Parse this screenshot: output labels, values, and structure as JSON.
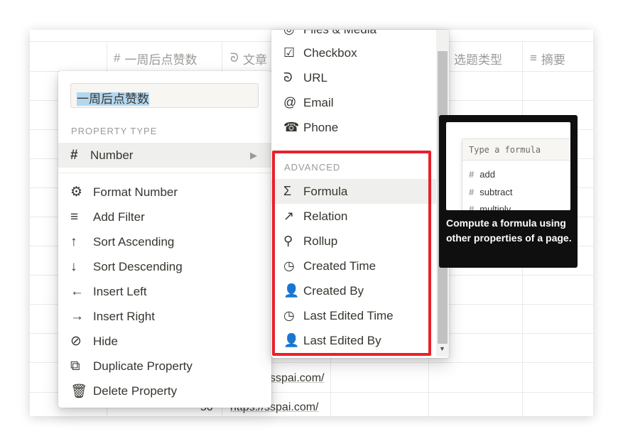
{
  "table": {
    "headers": [
      {
        "icon": "number-icon",
        "glyph": "#",
        "label": "一周后点赞数"
      },
      {
        "icon": "url-icon",
        "glyph": "ᘐ",
        "label": "文章"
      },
      {
        "icon": "select-icon",
        "glyph": "",
        "label": "选题类型"
      },
      {
        "icon": "text-icon",
        "glyph": "≡",
        "label": "摘要"
      }
    ],
    "rows_visible": [
      {
        "number": "",
        "link": "sspai.com/"
      },
      {
        "number": "50",
        "link": "https://sspai.com/"
      }
    ]
  },
  "property_menu": {
    "name_value": "一周后点赞数",
    "section_label": "PROPERTY TYPE",
    "selected_type": {
      "icon": "number-icon",
      "glyph": "#",
      "label": "Number"
    },
    "items": [
      {
        "name": "format-number",
        "icon": "gear-icon",
        "glyph": "⚙",
        "label": "Format Number"
      },
      {
        "name": "add-filter",
        "icon": "filter-icon",
        "glyph": "≡",
        "label": "Add Filter"
      },
      {
        "name": "sort-ascending",
        "icon": "arrow-up-icon",
        "glyph": "↑",
        "label": "Sort Ascending"
      },
      {
        "name": "sort-descending",
        "icon": "arrow-down-icon",
        "glyph": "↓",
        "label": "Sort Descending"
      },
      {
        "name": "insert-left",
        "icon": "arrow-left-icon",
        "glyph": "←",
        "label": "Insert Left"
      },
      {
        "name": "insert-right",
        "icon": "arrow-right-icon",
        "glyph": "→",
        "label": "Insert Right"
      },
      {
        "name": "hide",
        "icon": "eye-slash-icon",
        "glyph": "⊘",
        "label": "Hide"
      },
      {
        "name": "duplicate-property",
        "icon": "duplicate-icon",
        "glyph": "⧉",
        "label": "Duplicate Property"
      },
      {
        "name": "delete-property",
        "icon": "trash-icon",
        "glyph": "🗑",
        "label": "Delete Property"
      }
    ]
  },
  "type_menu": {
    "basic_items": [
      {
        "name": "files-media",
        "icon": "paperclip-icon",
        "glyph": "◎",
        "label": "Files & Media"
      },
      {
        "name": "checkbox",
        "icon": "checkbox-icon",
        "glyph": "☑",
        "label": "Checkbox"
      },
      {
        "name": "url",
        "icon": "link-icon",
        "glyph": "ᘐ",
        "label": "URL"
      },
      {
        "name": "email",
        "icon": "at-icon",
        "glyph": "@",
        "label": "Email"
      },
      {
        "name": "phone",
        "icon": "phone-icon",
        "glyph": "☎",
        "label": "Phone"
      }
    ],
    "advanced_label": "ADVANCED",
    "advanced_items": [
      {
        "name": "formula",
        "icon": "sigma-icon",
        "glyph": "Σ",
        "label": "Formula"
      },
      {
        "name": "relation",
        "icon": "arrow-up-right-icon",
        "glyph": "↗",
        "label": "Relation"
      },
      {
        "name": "rollup",
        "icon": "search-icon",
        "glyph": "⚲",
        "label": "Rollup"
      },
      {
        "name": "created-time",
        "icon": "clock-icon",
        "glyph": "◷",
        "label": "Created Time"
      },
      {
        "name": "created-by",
        "icon": "person-icon",
        "glyph": "👤",
        "label": "Created By"
      },
      {
        "name": "last-edited-time",
        "icon": "clock-icon",
        "glyph": "◷",
        "label": "Last Edited Time"
      },
      {
        "name": "last-edited-by",
        "icon": "person-icon",
        "glyph": "👤",
        "label": "Last Edited By"
      }
    ],
    "highlight_color": "#e8202a"
  },
  "tooltip": {
    "preview_placeholder": "Type a formula",
    "preview_items": [
      {
        "glyph": "#",
        "label": "add"
      },
      {
        "glyph": "#",
        "label": "subtract"
      },
      {
        "glyph": "#",
        "label": "multiply"
      }
    ],
    "description": "Compute a formula using other properties of a page."
  }
}
